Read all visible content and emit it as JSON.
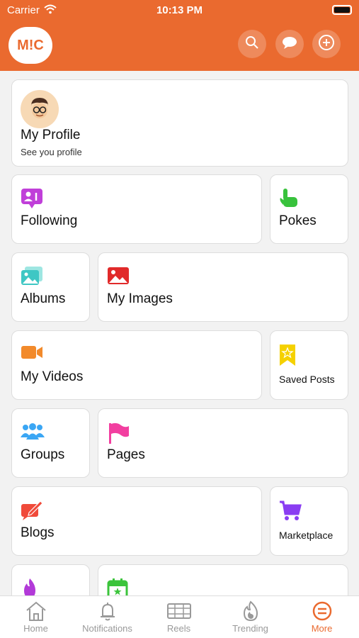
{
  "status_bar": {
    "carrier": "Carrier",
    "time": "10:13 PM"
  },
  "header": {
    "logo_text": "M!C"
  },
  "cards": [
    {
      "label": "My Profile",
      "subtitle": "See you profile"
    },
    {
      "label": "Following"
    },
    {
      "label": "Pokes"
    },
    {
      "label": "Albums"
    },
    {
      "label": "My Images"
    },
    {
      "label": "My Videos"
    },
    {
      "label": "Saved Posts"
    },
    {
      "label": "Groups"
    },
    {
      "label": "Pages"
    },
    {
      "label": "Blogs"
    },
    {
      "label": "Marketplace"
    }
  ],
  "bottom_nav": [
    {
      "label": "Home"
    },
    {
      "label": "Notifications"
    },
    {
      "label": "Reels"
    },
    {
      "label": "Trending"
    },
    {
      "label": "More",
      "active": true
    }
  ],
  "colors": {
    "accent": "#ea6a2f",
    "following_icon": "#c03fd9",
    "pokes_icon": "#38c23c",
    "albums_icon": "#3fc7c4",
    "images_icon": "#e12a2a",
    "videos_icon": "#f28a2b",
    "saved_icon": "#f5d100",
    "groups_icon": "#3aa6f4",
    "pages_icon": "#f23fa0",
    "blogs_icon": "#f04a3a",
    "marketplace_icon": "#8a3df2"
  }
}
